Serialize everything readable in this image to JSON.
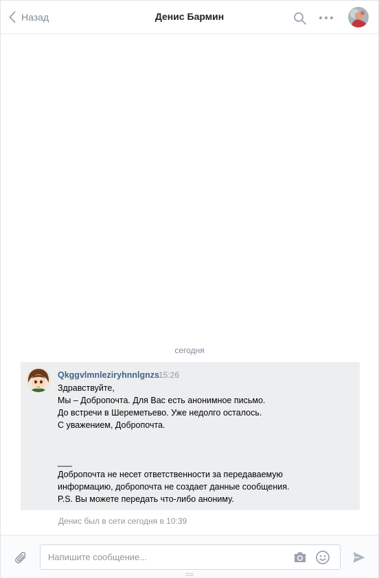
{
  "header": {
    "back_label": "Назад",
    "title": "Денис Бармин"
  },
  "chat": {
    "date_separator": "сегодня",
    "message": {
      "author": "Qkggvlmnleziryhnnlgnzs",
      "time": "15:26",
      "lines": [
        "Здравствуйте,",
        "Мы – Добропочта. Для Вас есть анонимное письмо.",
        "До встречи в Шереметьево. Уже недолго осталось.",
        "С уважением, Добропочта.",
        "",
        "",
        "___",
        "Добропочта не несет ответственности за передаваемую",
        "информацию, добропочта не создает данные сообщения.",
        "P.S. Вы можете передать что-либо анониму."
      ]
    },
    "status": "Денис был в сети сегодня в 10:39"
  },
  "composer": {
    "placeholder": "Напишите сообщение..."
  },
  "icons": {
    "back": "chevron-left-icon",
    "search": "search-icon",
    "more": "more-dots-icon",
    "attach": "paperclip-icon",
    "camera": "camera-icon",
    "emoji": "smile-icon",
    "send": "send-icon"
  },
  "colors": {
    "author_link": "#42648b",
    "message_bg": "#edeef0",
    "muted": "#939699",
    "icon": "#99a2ad"
  }
}
